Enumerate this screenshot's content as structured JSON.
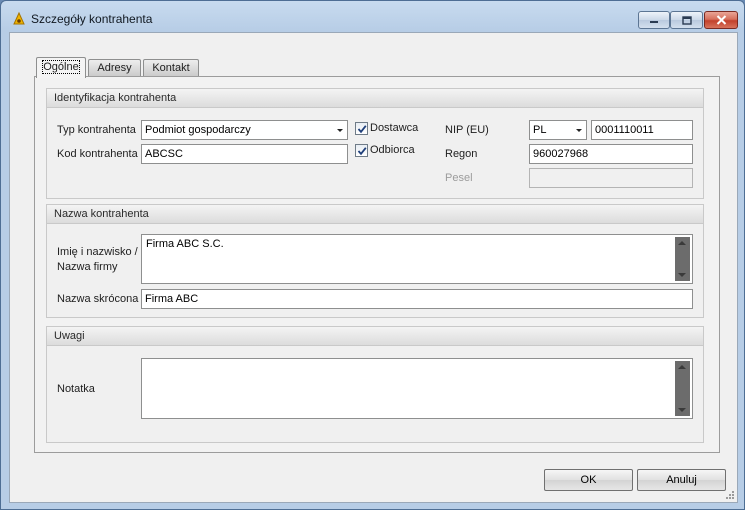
{
  "window": {
    "title": "Szczegóły kontrahenta",
    "accent_color": "#b7cde6",
    "close_color": "#c2412c"
  },
  "tabs": [
    {
      "label": "Ogólne",
      "active": true
    },
    {
      "label": "Adresy",
      "active": false
    },
    {
      "label": "Kontakt",
      "active": false
    }
  ],
  "identyfikacja": {
    "header": "Identyfikacja kontrahenta",
    "typ_label": "Typ kontrahenta",
    "typ_value": "Podmiot gospodarczy",
    "kod_label": "Kod kontrahenta",
    "kod_value": "ABCSC",
    "dostawca_label": "Dostawca",
    "dostawca_checked": true,
    "odbiorca_label": "Odbiorca",
    "odbiorca_checked": true,
    "nip_label": "NIP (EU)",
    "nip_country": "PL",
    "nip_value": "0001110011",
    "regon_label": "Regon",
    "regon_value": "960027968",
    "pesel_label": "Pesel",
    "pesel_value": ""
  },
  "nazwa": {
    "header": "Nazwa kontrahenta",
    "imie_label_line1": "Imię i nazwisko /",
    "imie_label_line2": "Nazwa firmy",
    "imie_value": "Firma ABC S.C.",
    "skrocona_label": "Nazwa skrócona",
    "skrocona_value": "Firma ABC"
  },
  "uwagi": {
    "header": "Uwagi",
    "notatka_label": "Notatka",
    "notatka_value": ""
  },
  "buttons": {
    "ok": "OK",
    "cancel": "Anuluj"
  }
}
